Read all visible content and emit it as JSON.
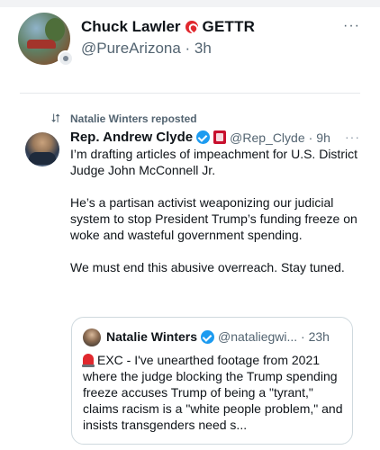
{
  "header_post": {
    "name": "Chuck Lawler",
    "platform_label": "GETTR",
    "handle_time": "@PureArizona · 3h",
    "more": "···"
  },
  "repost": {
    "text": "Natalie Winters reposted"
  },
  "tweet": {
    "author_name": "Rep. Andrew Clyde",
    "handle": "@Rep_Clyde",
    "separator": "·",
    "time": "9h",
    "more": "···",
    "paragraphs": [
      "I’m drafting articles of impeachment for U.S. District Judge John McConnell Jr.",
      "He’s a partisan activist weaponizing our judicial system to stop President Trump’s funding freeze on woke and wasteful government spending.",
      "We must end this abusive overreach. Stay tuned."
    ]
  },
  "quoted": {
    "author_name": "Natalie Winters",
    "handle_time": "@nataliegwi... · 23h",
    "text": "EXC - I've unearthed footage from 2021 where the  judge blocking the Trump spending freeze accuses Trump of being a \"tyrant,\" claims racism is a \"white people problem,\" and insists transgenders need s..."
  },
  "colors": {
    "verified": "#1d9bf0",
    "gettr": "#e0282e",
    "muted_text": "#536471"
  }
}
